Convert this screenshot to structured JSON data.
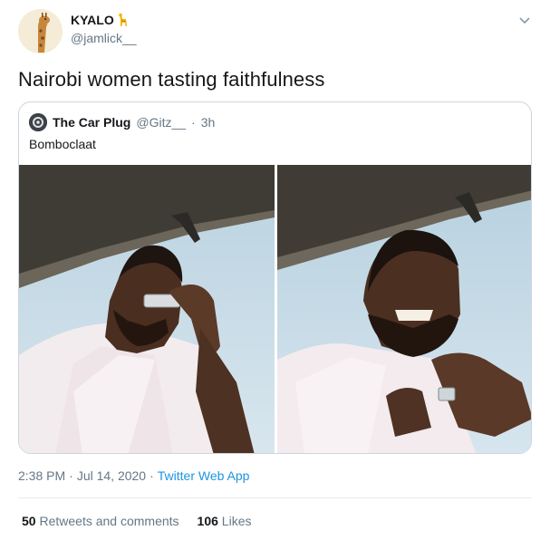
{
  "author": {
    "name": "KYALO",
    "handle": "@jamlick__",
    "emoji": "giraffe-emoji"
  },
  "tweet": {
    "text": "Nairobi women tasting faithfulness"
  },
  "quoted": {
    "name": "The Car Plug",
    "handle": "@Gitz__",
    "separator": "·",
    "time": "3h",
    "text": "Bomboclaat"
  },
  "meta": {
    "time": "2:38 PM",
    "separator1": "·",
    "date": "Jul 14, 2020",
    "separator2": "·",
    "source": "Twitter Web App"
  },
  "stats": {
    "retweets_count": "50",
    "retweets_label": "Retweets and comments",
    "likes_count": "106",
    "likes_label": "Likes"
  },
  "colors": {
    "link": "#1b95e0",
    "secondary_text": "#657786",
    "border": "#ccd6dd"
  }
}
